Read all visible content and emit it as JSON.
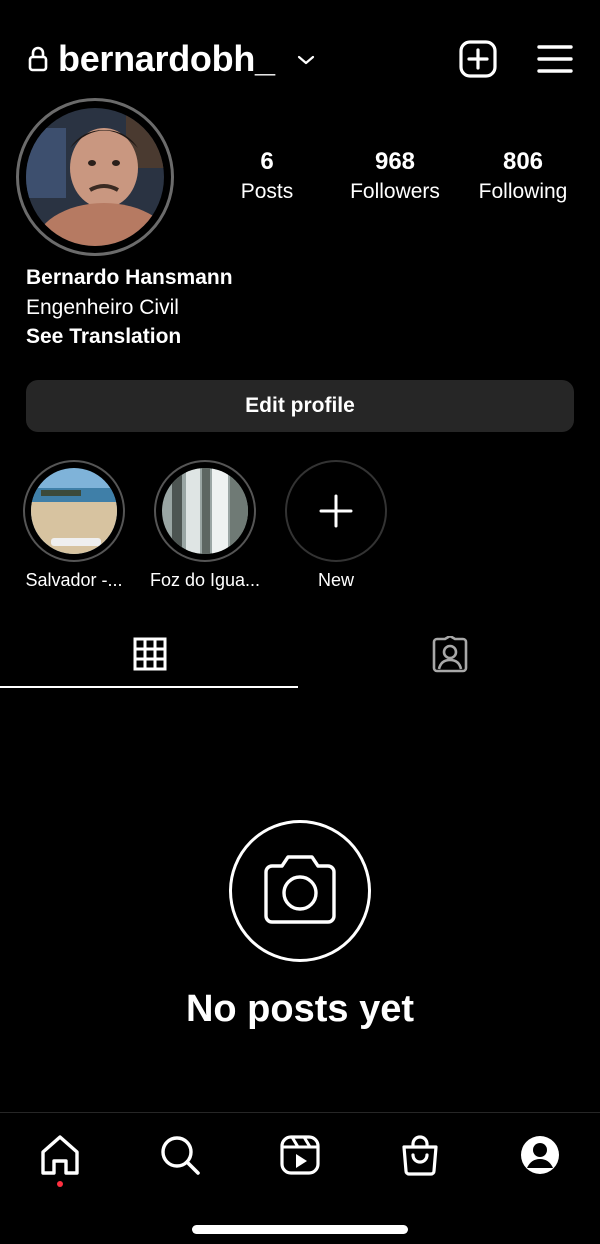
{
  "header": {
    "username": "bernardobh_"
  },
  "profile": {
    "stats": [
      {
        "value": "6",
        "label": "Posts"
      },
      {
        "value": "968",
        "label": "Followers"
      },
      {
        "value": "806",
        "label": "Following"
      }
    ],
    "full_name": "Bernardo Hansmann",
    "bio": "Engenheiro Civil",
    "see_translation": "See Translation",
    "edit_profile_label": "Edit profile"
  },
  "highlights": [
    {
      "label": "Salvador -..."
    },
    {
      "label": "Foz do Igua..."
    },
    {
      "label": "New"
    }
  ],
  "empty_state": {
    "title": "No posts yet"
  },
  "nav_icons": [
    "home-icon",
    "search-icon",
    "reels-icon",
    "shop-icon",
    "profile-icon"
  ],
  "colors": {
    "background": "#000000",
    "button_bg": "#262626",
    "notification_dot": "#ff3040"
  }
}
